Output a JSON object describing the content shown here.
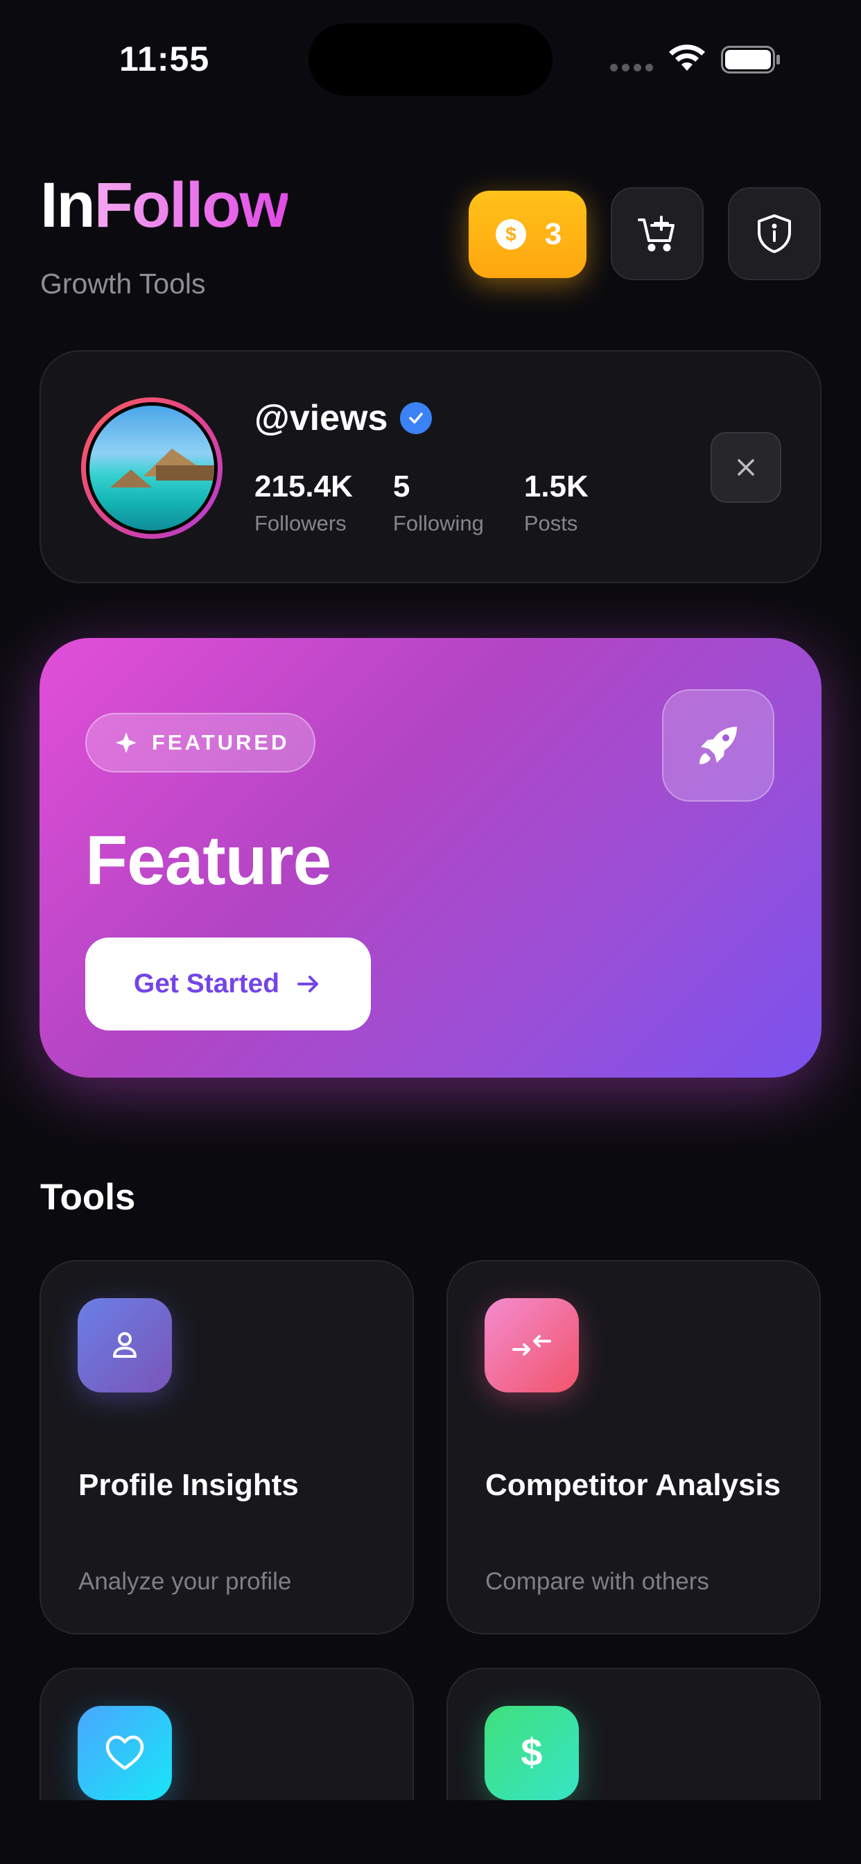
{
  "status_bar": {
    "time": "11:55"
  },
  "header": {
    "title_part1": "In",
    "title_part2": "Follow",
    "subtitle": "Growth Tools",
    "coins": "3",
    "icons": {
      "coin": "dollar-coin-icon",
      "cart": "cart-add-icon",
      "shield": "shield-info-icon"
    }
  },
  "profile": {
    "username": "@views",
    "verified": true,
    "stats": [
      {
        "value": "215.4K",
        "label": "Followers"
      },
      {
        "value": "5",
        "label": "Following"
      },
      {
        "value": "1.5K",
        "label": "Posts"
      }
    ]
  },
  "feature": {
    "badge": "FEATURED",
    "title": "Feature",
    "cta": "Get Started",
    "icon": "rocket-icon"
  },
  "tools": {
    "section_title": "Tools",
    "items": [
      {
        "title": "Profile Insights",
        "desc": "Analyze your profile",
        "icon": "person-icon"
      },
      {
        "title": "Competitor Analysis",
        "desc": "Compare with others",
        "icon": "compare-arrows-icon"
      },
      {
        "title": "",
        "desc": "",
        "icon": "heart-icon"
      },
      {
        "title": "",
        "desc": "",
        "icon": "dollar-icon"
      }
    ]
  },
  "colors": {
    "background": "#0b0b0f",
    "accent_pink": "#e14be6",
    "coin_yellow": "#ffb015",
    "verified_blue": "#3b82f6",
    "cta_purple": "#7444e8"
  }
}
